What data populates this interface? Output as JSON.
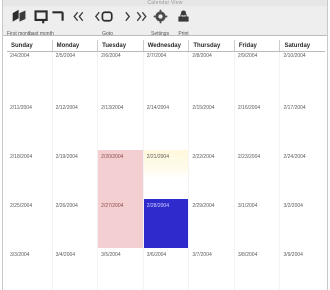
{
  "window": {
    "title": "Calendar View"
  },
  "toolbar": {
    "buttons": [
      {
        "label": "First month",
        "icon": "first-month-icon"
      },
      {
        "label": "Last month",
        "icon": "last-month-icon"
      },
      {
        "label": "",
        "icon": "previous-icon"
      },
      {
        "label": "",
        "icon": "back-icon"
      },
      {
        "label": "Goto",
        "icon": "goto-icon"
      },
      {
        "label": "",
        "icon": "forward-icon"
      },
      {
        "label": "",
        "icon": "next-icon"
      },
      {
        "label": "Settings",
        "icon": "settings-icon"
      },
      {
        "label": "Print",
        "icon": "print-icon"
      }
    ]
  },
  "calendar": {
    "headers": [
      "Sunday",
      "Monday",
      "Tuesday",
      "Wednesday",
      "Thursday",
      "Friday",
      "Saturday"
    ],
    "weeks": [
      [
        "2/4/2004",
        "2/5/2004",
        "2/6/2004",
        "2/7/2004",
        "2/8/2004",
        "2/9/2004",
        "2/10/2004"
      ],
      [
        "2/11/2004",
        "2/12/2004",
        "2/13/2004",
        "2/14/2004",
        "2/15/2004",
        "2/16/2004",
        "2/17/2004"
      ],
      [
        "2/18/2004",
        "2/19/2004",
        "2/20/2004",
        "2/21/2004",
        "2/22/2004",
        "2/23/2004",
        "2/24/2004"
      ],
      [
        "2/25/2004",
        "2/26/2004",
        "2/27/2004",
        "2/28/2004",
        "2/29/2004",
        "3/1/2004",
        "3/2/2004"
      ],
      [
        "3/3/2004",
        "3/4/2004",
        "3/5/2004",
        "3/6/2004",
        "3/7/2004",
        "3/8/2004",
        "3/9/2004"
      ]
    ],
    "highlight_colors": {
      "pink": "#f3cfd1",
      "yellow": "#fff8dc",
      "blue": "#2e2acc"
    }
  }
}
